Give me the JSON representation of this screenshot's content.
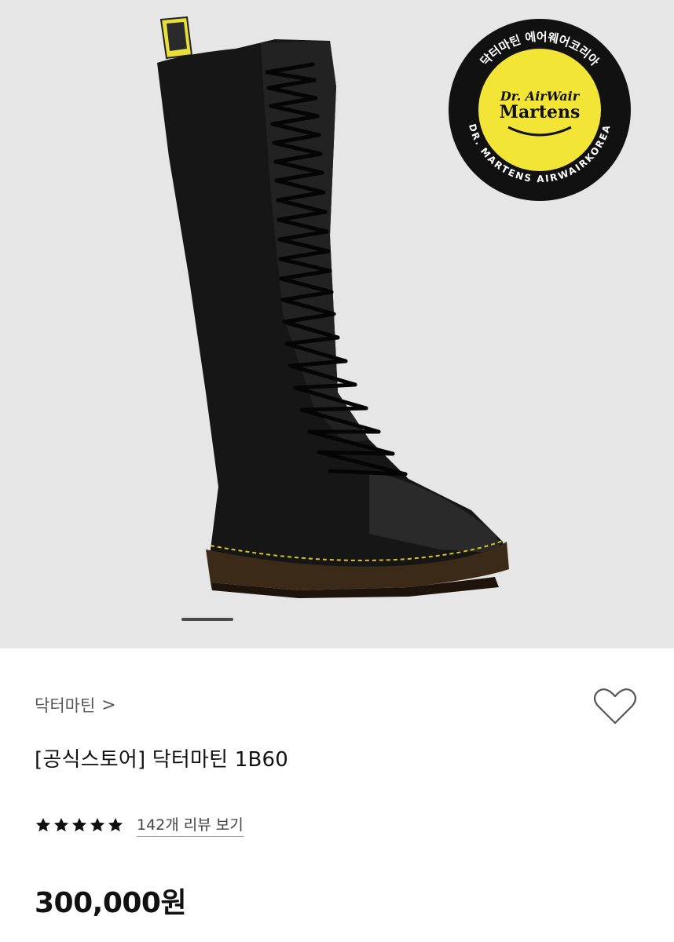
{
  "product": {
    "brand": "닥터마틴",
    "brand_chevron": ">",
    "title": "[공식스토어] 닥터마틴 1B60",
    "rating_stars": 5,
    "review_link": "142개 리뷰 보기",
    "price": "300,000원"
  },
  "badge": {
    "top_text": "닥터마틴 에어웨어코리아",
    "ring_text": "DR. MARTENS AIRWAIRKOREA",
    "logo_line1": "Dr. AirWair",
    "logo_line2": "Martens",
    "ring_color": "#111111",
    "center_color": "#f2e535"
  },
  "gallery": {
    "current_index": 1
  },
  "colors": {
    "hero_bg": "#e6e6e6",
    "text": "#111111",
    "muted": "#555555"
  }
}
